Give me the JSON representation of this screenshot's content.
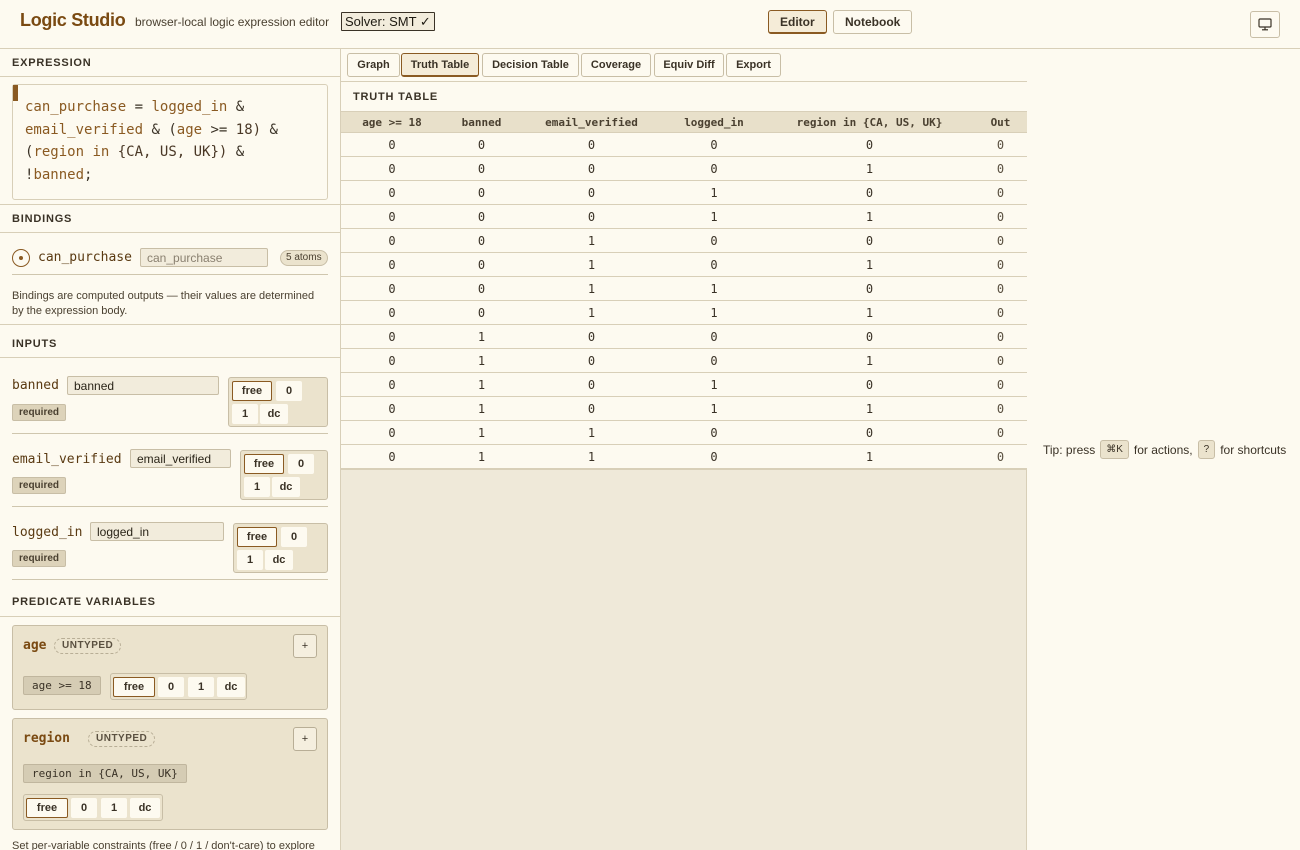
{
  "header": {
    "title": "Logic Studio",
    "subtitle": "browser-local logic expression editor",
    "solver_label": "Solver: SMT ✓",
    "mode_editor": "Editor",
    "mode_notebook": "Notebook",
    "monitor_icon": "monitor-icon"
  },
  "expression": {
    "heading": "EXPRESSION",
    "target": "can_purchase",
    "eq": "=",
    "t1": "logged_in",
    "amp": "&",
    "t2": "email_verified",
    "t3a": "(",
    "t3b": "age",
    "t3c": ">=",
    "t3d": "18)",
    "t4a": "(",
    "t4b": "region",
    "t4c": "in",
    "t4d": "{CA, US, UK})",
    "t5a": "!",
    "t5b": "banned",
    "end": ";"
  },
  "bindings": {
    "heading": "BINDINGS",
    "name": "can_purchase",
    "value": "can_purchase",
    "atoms": "5 atoms",
    "note": "Bindings are computed outputs — their values are determined by the expression body."
  },
  "inputs": {
    "heading": "INPUTS",
    "items": [
      {
        "name": "banned",
        "value": "banned",
        "badge": "required"
      },
      {
        "name": "email_verified",
        "value": "email_verified",
        "badge": "required"
      },
      {
        "name": "logged_in",
        "value": "logged_in",
        "badge": "required"
      }
    ],
    "tri_labels": {
      "free": "free",
      "zero": "0",
      "one": "1",
      "dc": "dc"
    }
  },
  "predicates": {
    "heading": "PREDICATE VARIABLES",
    "items": [
      {
        "name": "age",
        "tag": "UNTYPED",
        "expr": "age >= 18"
      },
      {
        "name": "region",
        "tag": "UNTYPED",
        "expr": "region in {CA, US, UK}"
      }
    ],
    "plus": "+",
    "note": "Set per-variable constraints (free / 0 / 1 / don't-care) to explore"
  },
  "tabs": [
    "Graph",
    "Truth Table",
    "Decision Table",
    "Coverage",
    "Equiv Diff",
    "Export"
  ],
  "active_tab": "Truth Table",
  "truth_table": {
    "title": "TRUTH TABLE",
    "columns": [
      "age >= 18",
      "banned",
      "email_verified",
      "logged_in",
      "region in {CA, US, UK}",
      "Out"
    ],
    "rows": [
      [
        "0",
        "0",
        "0",
        "0",
        "0",
        "0"
      ],
      [
        "0",
        "0",
        "0",
        "0",
        "1",
        "0"
      ],
      [
        "0",
        "0",
        "0",
        "1",
        "0",
        "0"
      ],
      [
        "0",
        "0",
        "0",
        "1",
        "1",
        "0"
      ],
      [
        "0",
        "0",
        "1",
        "0",
        "0",
        "0"
      ],
      [
        "0",
        "0",
        "1",
        "0",
        "1",
        "0"
      ],
      [
        "0",
        "0",
        "1",
        "1",
        "0",
        "0"
      ],
      [
        "0",
        "0",
        "1",
        "1",
        "1",
        "0"
      ],
      [
        "0",
        "1",
        "0",
        "0",
        "0",
        "0"
      ],
      [
        "0",
        "1",
        "0",
        "0",
        "1",
        "0"
      ],
      [
        "0",
        "1",
        "0",
        "1",
        "0",
        "0"
      ],
      [
        "0",
        "1",
        "0",
        "1",
        "1",
        "0"
      ],
      [
        "0",
        "1",
        "1",
        "0",
        "0",
        "0"
      ],
      [
        "0",
        "1",
        "1",
        "0",
        "1",
        "0"
      ]
    ]
  },
  "tip": {
    "prefix": "Tip: press",
    "key1": "⌘K",
    "mid": "for actions,",
    "key2": "?",
    "suffix": "for shortcuts"
  }
}
